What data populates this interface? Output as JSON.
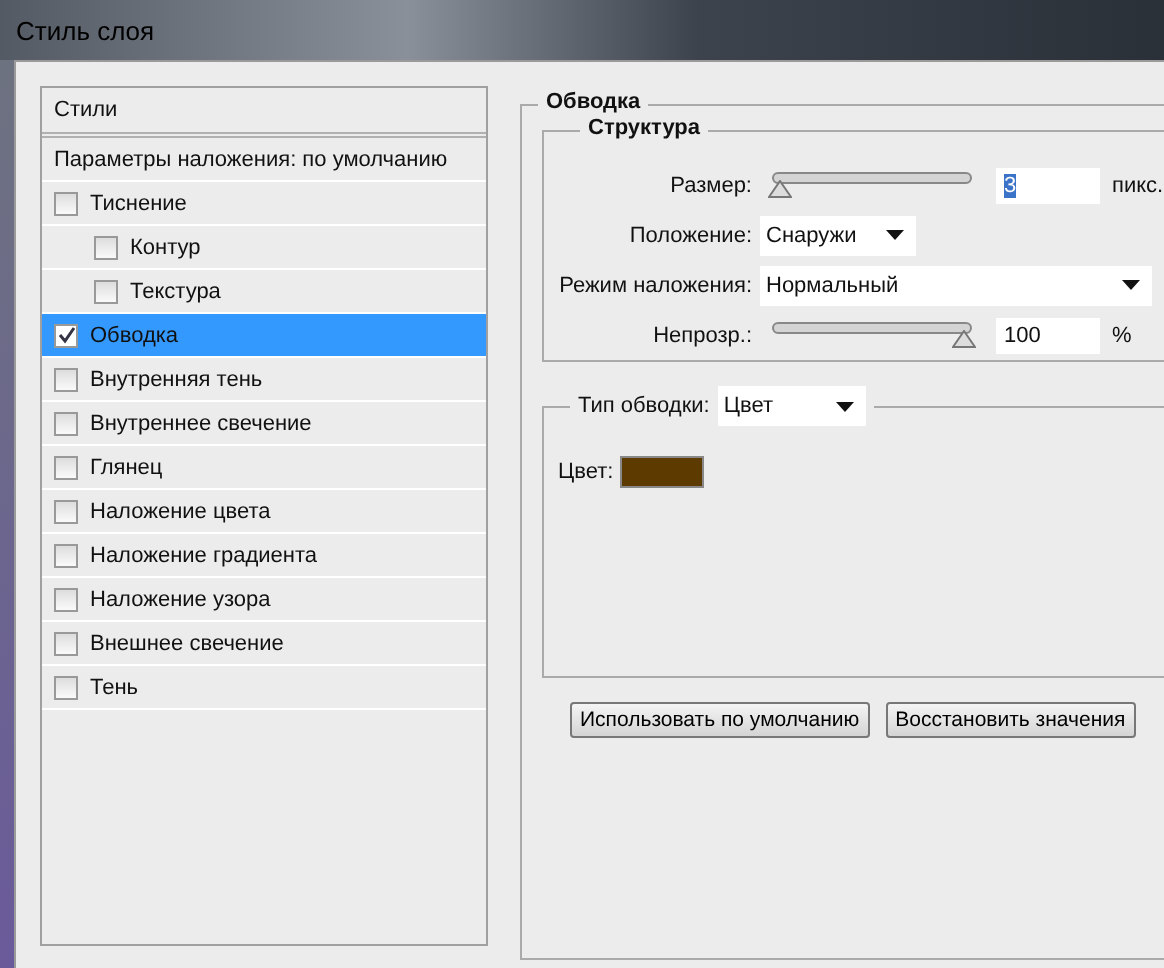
{
  "window": {
    "title": "Стиль слоя"
  },
  "styles_panel": {
    "header": "Стили",
    "blending_options": "Параметры наложения: по умолчанию",
    "items": [
      {
        "label": "Тиснение",
        "checked": false,
        "selected": false,
        "children": [
          {
            "label": "Контур",
            "checked": false,
            "selected": false
          },
          {
            "label": "Текстура",
            "checked": false,
            "selected": false
          }
        ]
      },
      {
        "label": "Обводка",
        "checked": true,
        "selected": true
      },
      {
        "label": "Внутренняя тень",
        "checked": false,
        "selected": false
      },
      {
        "label": "Внутреннее свечение",
        "checked": false,
        "selected": false
      },
      {
        "label": "Глянец",
        "checked": false,
        "selected": false
      },
      {
        "label": "Наложение цвета",
        "checked": false,
        "selected": false
      },
      {
        "label": "Наложение градиента",
        "checked": false,
        "selected": false
      },
      {
        "label": "Наложение узора",
        "checked": false,
        "selected": false
      },
      {
        "label": "Внешнее свечение",
        "checked": false,
        "selected": false
      },
      {
        "label": "Тень",
        "checked": false,
        "selected": false
      }
    ]
  },
  "stroke": {
    "title": "Обводка",
    "structure": {
      "title": "Структура",
      "rows": [
        {
          "kind": "slider",
          "label": "Размер:",
          "level": 0.0,
          "value": "3",
          "unit": "пикс."
        },
        {
          "kind": "dropdown",
          "label": "Положение:",
          "value": "Снаружи"
        },
        {
          "kind": "wide_dropdown",
          "label": "Режим наложения:",
          "value": "Нормальный"
        },
        {
          "kind": "slider",
          "label": "Непрозр.:",
          "level": 1.0,
          "value": "100",
          "unit": "%"
        }
      ]
    },
    "fill": {
      "label": "Тип обводки:",
      "value": "Цвет",
      "color_label": "Цвет:",
      "color": "#5c3a00"
    },
    "buttons": [
      "Использовать по умолчанию",
      "Восстановить значения"
    ]
  }
}
